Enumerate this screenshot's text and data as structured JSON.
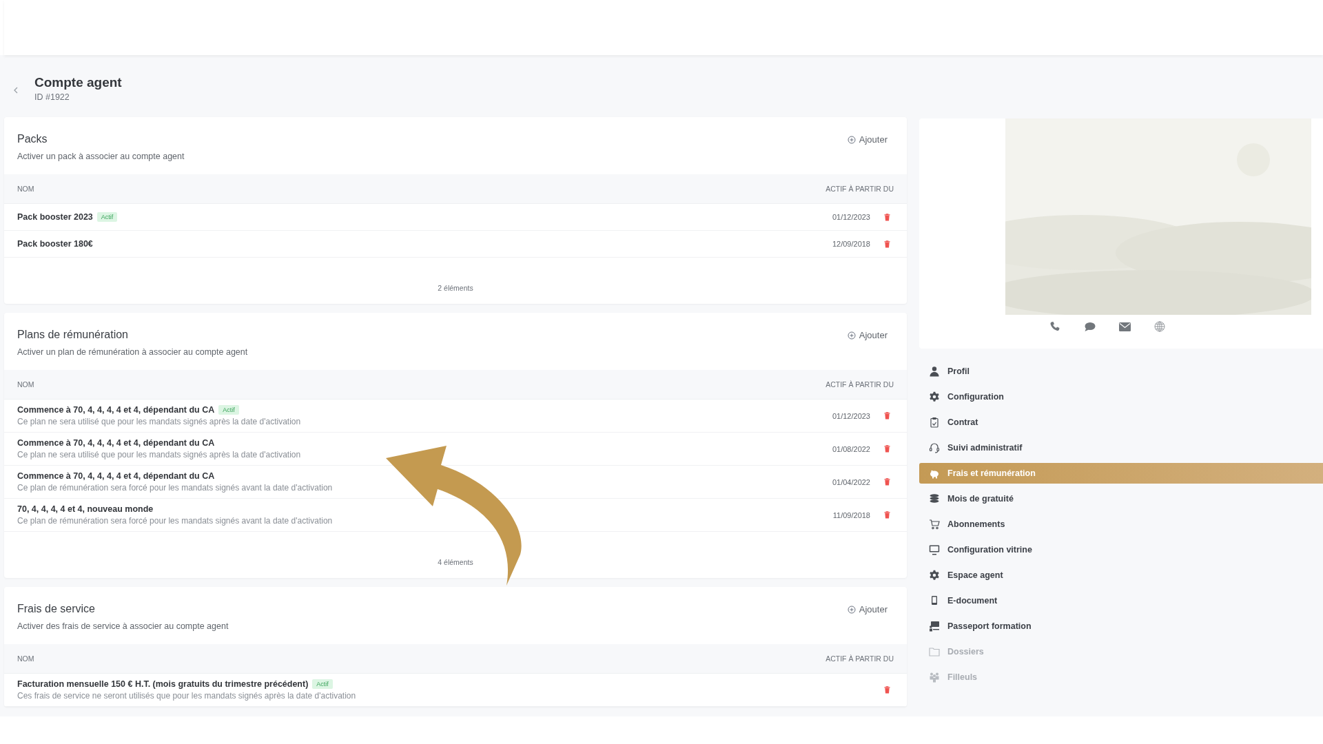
{
  "header": {
    "title": "Compte agent",
    "subtitle": "ID #1922"
  },
  "sections": [
    {
      "title": "Packs",
      "description": "Activer un pack à associer au compte agent",
      "add_label": "Ajouter",
      "columns": [
        "NOM",
        "ACTIF À PARTIR DU"
      ],
      "footer": "2 éléments",
      "rows": [
        {
          "name": "Pack booster 2023",
          "badge": "Actif",
          "date": "01/12/2023"
        },
        {
          "name": "Pack booster 180€",
          "date": "12/09/2018"
        }
      ]
    },
    {
      "title": "Plans de rémunération",
      "description": "Activer un plan de rémunération à associer au compte agent",
      "add_label": "Ajouter",
      "columns": [
        "NOM",
        "ACTIF À PARTIR DU"
      ],
      "footer": "4 éléments",
      "rows": [
        {
          "name": "Commence à 70, 4, 4, 4, 4 et 4, dépendant du CA",
          "badge": "Actif",
          "note": "Ce plan ne sera utilisé que pour les mandats signés après la date d'activation",
          "date": "01/12/2023"
        },
        {
          "name": "Commence à 70, 4, 4, 4, 4 et 4, dépendant du CA",
          "note": "Ce plan ne sera utilisé que pour les mandats signés après la date d'activation",
          "date": "01/08/2022"
        },
        {
          "name": "Commence à 70, 4, 4, 4, 4 et 4, dépendant du CA",
          "note": "Ce plan de rémunération sera forcé pour les mandats signés avant la date d'activation",
          "date": "01/04/2022"
        },
        {
          "name": "70, 4, 4, 4, 4 et 4, nouveau monde",
          "note": "Ce plan de rémunération sera forcé pour les mandats signés avant la date d'activation",
          "date": "11/09/2018"
        }
      ]
    },
    {
      "title": "Frais de service",
      "description": "Activer des frais de service à associer au compte agent",
      "add_label": "Ajouter",
      "columns": [
        "NOM",
        "ACTIF À PARTIR DU"
      ],
      "rows": [
        {
          "name": "Facturation mensuelle 150 € H.T. (mois gratuits du trimestre précédent)",
          "badge": "Actif",
          "note": "Ces frais de service ne seront utilisés que pour les mandats signés après la date d'activation"
        }
      ]
    }
  ],
  "nav": [
    {
      "label": "Profil",
      "selected": false,
      "disabled": false
    },
    {
      "label": "Configuration",
      "selected": false,
      "disabled": false
    },
    {
      "label": "Contrat",
      "selected": false,
      "disabled": false
    },
    {
      "label": "Suivi administratif",
      "selected": false,
      "disabled": false
    },
    {
      "label": "Frais et rémunération",
      "selected": true,
      "disabled": false
    },
    {
      "label": "Mois de gratuité",
      "selected": false,
      "disabled": false
    },
    {
      "label": "Abonnements",
      "selected": false,
      "disabled": false
    },
    {
      "label": "Configuration vitrine",
      "selected": false,
      "disabled": false
    },
    {
      "label": "Espace agent",
      "selected": false,
      "disabled": false
    },
    {
      "label": "E-document",
      "selected": false,
      "disabled": false
    },
    {
      "label": "Passeport formation",
      "selected": false,
      "disabled": false
    },
    {
      "label": "Dossiers",
      "selected": false,
      "disabled": true
    },
    {
      "label": "Filleuls",
      "selected": false,
      "disabled": true
    }
  ]
}
